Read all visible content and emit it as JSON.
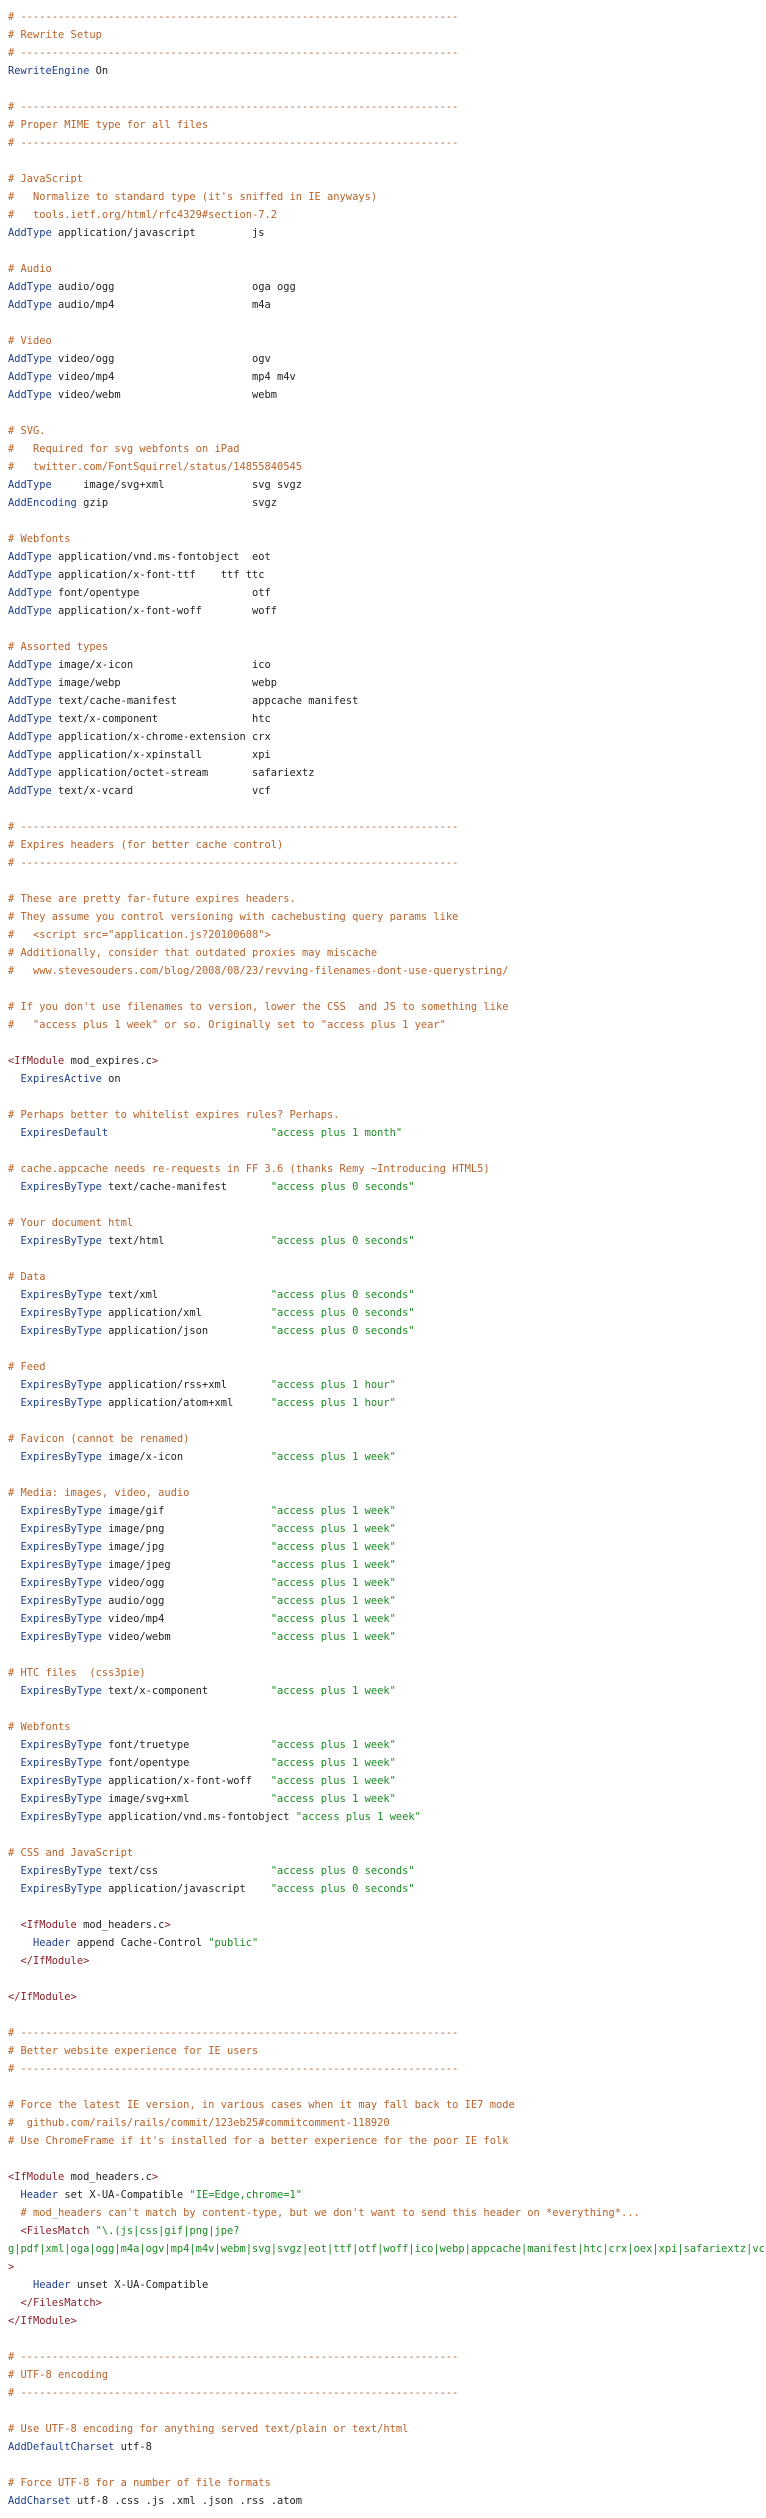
{
  "theme": {
    "comment": "#b8622a",
    "keyword": "#1d3f8a",
    "string": "#1a8a22",
    "plain": "#222222",
    "tag": "#8a1f2a"
  },
  "lines": [
    [
      [
        "c",
        "# ----------------------------------------------------------------------"
      ]
    ],
    [
      [
        "c",
        "# Rewrite Setup"
      ]
    ],
    [
      [
        "c",
        "# ----------------------------------------------------------------------"
      ]
    ],
    [
      [
        "k",
        "RewriteEngine"
      ],
      [
        "p",
        " On"
      ]
    ],
    [],
    [
      [
        "c",
        "# ----------------------------------------------------------------------"
      ]
    ],
    [
      [
        "c",
        "# Proper MIME type for all files"
      ]
    ],
    [
      [
        "c",
        "# ----------------------------------------------------------------------"
      ]
    ],
    [],
    [
      [
        "c",
        "# JavaScript"
      ]
    ],
    [
      [
        "c",
        "#   Normalize to standard type (it's sniffed in IE anyways)"
      ]
    ],
    [
      [
        "c",
        "#   tools.ietf.org/html/rfc4329#section-7.2"
      ]
    ],
    [
      [
        "k",
        "AddType"
      ],
      [
        "p",
        " application/javascript         js"
      ]
    ],
    [],
    [
      [
        "c",
        "# Audio"
      ]
    ],
    [
      [
        "k",
        "AddType"
      ],
      [
        "p",
        " audio/ogg                      oga ogg"
      ]
    ],
    [
      [
        "k",
        "AddType"
      ],
      [
        "p",
        " audio/mp4                      m4a"
      ]
    ],
    [],
    [
      [
        "c",
        "# Video"
      ]
    ],
    [
      [
        "k",
        "AddType"
      ],
      [
        "p",
        " video/ogg                      ogv"
      ]
    ],
    [
      [
        "k",
        "AddType"
      ],
      [
        "p",
        " video/mp4                      mp4 m4v"
      ]
    ],
    [
      [
        "k",
        "AddType"
      ],
      [
        "p",
        " video/webm                     webm"
      ]
    ],
    [],
    [
      [
        "c",
        "# SVG."
      ]
    ],
    [
      [
        "c",
        "#   Required for svg webfonts on iPad"
      ]
    ],
    [
      [
        "c",
        "#   twitter.com/FontSquirrel/status/14855840545"
      ]
    ],
    [
      [
        "k",
        "AddType"
      ],
      [
        "p",
        "     image/svg+xml              svg svgz"
      ]
    ],
    [
      [
        "k",
        "AddEncoding"
      ],
      [
        "p",
        " gzip                       svgz"
      ]
    ],
    [],
    [
      [
        "c",
        "# Webfonts"
      ]
    ],
    [
      [
        "k",
        "AddType"
      ],
      [
        "p",
        " application/vnd.ms-fontobject  eot"
      ]
    ],
    [
      [
        "k",
        "AddType"
      ],
      [
        "p",
        " application/x-font-ttf    ttf ttc"
      ]
    ],
    [
      [
        "k",
        "AddType"
      ],
      [
        "p",
        " font/opentype                  otf"
      ]
    ],
    [
      [
        "k",
        "AddType"
      ],
      [
        "p",
        " application/x-font-woff        woff"
      ]
    ],
    [],
    [
      [
        "c",
        "# Assorted types"
      ]
    ],
    [
      [
        "k",
        "AddType"
      ],
      [
        "p",
        " image/x-icon                   ico"
      ]
    ],
    [
      [
        "k",
        "AddType"
      ],
      [
        "p",
        " image/webp                     webp"
      ]
    ],
    [
      [
        "k",
        "AddType"
      ],
      [
        "p",
        " text/cache-manifest            appcache manifest"
      ]
    ],
    [
      [
        "k",
        "AddType"
      ],
      [
        "p",
        " text/x-component               htc"
      ]
    ],
    [
      [
        "k",
        "AddType"
      ],
      [
        "p",
        " application/x-chrome-extension crx"
      ]
    ],
    [
      [
        "k",
        "AddType"
      ],
      [
        "p",
        " application/x-xpinstall        xpi"
      ]
    ],
    [
      [
        "k",
        "AddType"
      ],
      [
        "p",
        " application/octet-stream       safariextz"
      ]
    ],
    [
      [
        "k",
        "AddType"
      ],
      [
        "p",
        " text/x-vcard                   vcf"
      ]
    ],
    [],
    [
      [
        "c",
        "# ----------------------------------------------------------------------"
      ]
    ],
    [
      [
        "c",
        "# Expires headers (for better cache control)"
      ]
    ],
    [
      [
        "c",
        "# ----------------------------------------------------------------------"
      ]
    ],
    [],
    [
      [
        "c",
        "# These are pretty far-future expires headers."
      ]
    ],
    [
      [
        "c",
        "# They assume you control versioning with cachebusting query params like"
      ]
    ],
    [
      [
        "c",
        "#   <script src=\"application.js?20100608\">"
      ]
    ],
    [
      [
        "c",
        "# Additionally, consider that outdated proxies may miscache"
      ]
    ],
    [
      [
        "c",
        "#   www.stevesouders.com/blog/2008/08/23/revving-filenames-dont-use-querystring/"
      ]
    ],
    [],
    [
      [
        "c",
        "# If you don't use filenames to version, lower the CSS  and JS to something like"
      ]
    ],
    [
      [
        "c",
        "#   \"access plus 1 week\" or so. Originally set to \"access plus 1 year\""
      ]
    ],
    [],
    [
      [
        "g",
        "<IfModule"
      ],
      [
        "p",
        " mod_expires.c"
      ],
      [
        "g",
        ">"
      ]
    ],
    [
      [
        "p",
        "  "
      ],
      [
        "k",
        "ExpiresActive"
      ],
      [
        "p",
        " on"
      ]
    ],
    [],
    [
      [
        "c",
        "# Perhaps better to whitelist expires rules? Perhaps."
      ]
    ],
    [
      [
        "p",
        "  "
      ],
      [
        "k",
        "ExpiresDefault"
      ],
      [
        "p",
        "                          "
      ],
      [
        "s",
        "\"access plus 1 month\""
      ]
    ],
    [],
    [
      [
        "c",
        "# cache.appcache needs re-requests in FF 3.6 (thanks Remy ~Introducing HTML5)"
      ]
    ],
    [
      [
        "p",
        "  "
      ],
      [
        "k",
        "ExpiresByType"
      ],
      [
        "p",
        " text/cache-manifest       "
      ],
      [
        "s",
        "\"access plus 0 seconds\""
      ]
    ],
    [],
    [
      [
        "c",
        "# Your document html"
      ]
    ],
    [
      [
        "p",
        "  "
      ],
      [
        "k",
        "ExpiresByType"
      ],
      [
        "p",
        " text/html                 "
      ],
      [
        "s",
        "\"access plus 0 seconds\""
      ]
    ],
    [],
    [
      [
        "c",
        "# Data"
      ]
    ],
    [
      [
        "p",
        "  "
      ],
      [
        "k",
        "ExpiresByType"
      ],
      [
        "p",
        " text/xml                  "
      ],
      [
        "s",
        "\"access plus 0 seconds\""
      ]
    ],
    [
      [
        "p",
        "  "
      ],
      [
        "k",
        "ExpiresByType"
      ],
      [
        "p",
        " application/xml           "
      ],
      [
        "s",
        "\"access plus 0 seconds\""
      ]
    ],
    [
      [
        "p",
        "  "
      ],
      [
        "k",
        "ExpiresByType"
      ],
      [
        "p",
        " application/json          "
      ],
      [
        "s",
        "\"access plus 0 seconds\""
      ]
    ],
    [],
    [
      [
        "c",
        "# Feed"
      ]
    ],
    [
      [
        "p",
        "  "
      ],
      [
        "k",
        "ExpiresByType"
      ],
      [
        "p",
        " application/rss+xml       "
      ],
      [
        "s",
        "\"access plus 1 hour\""
      ]
    ],
    [
      [
        "p",
        "  "
      ],
      [
        "k",
        "ExpiresByType"
      ],
      [
        "p",
        " application/atom+xml      "
      ],
      [
        "s",
        "\"access plus 1 hour\""
      ]
    ],
    [],
    [
      [
        "c",
        "# Favicon (cannot be renamed)"
      ]
    ],
    [
      [
        "p",
        "  "
      ],
      [
        "k",
        "ExpiresByType"
      ],
      [
        "p",
        " image/x-icon              "
      ],
      [
        "s",
        "\"access plus 1 week\""
      ]
    ],
    [],
    [
      [
        "c",
        "# Media: images, video, audio"
      ]
    ],
    [
      [
        "p",
        "  "
      ],
      [
        "k",
        "ExpiresByType"
      ],
      [
        "p",
        " image/gif                 "
      ],
      [
        "s",
        "\"access plus 1 week\""
      ]
    ],
    [
      [
        "p",
        "  "
      ],
      [
        "k",
        "ExpiresByType"
      ],
      [
        "p",
        " image/png                 "
      ],
      [
        "s",
        "\"access plus 1 week\""
      ]
    ],
    [
      [
        "p",
        "  "
      ],
      [
        "k",
        "ExpiresByType"
      ],
      [
        "p",
        " image/jpg                 "
      ],
      [
        "s",
        "\"access plus 1 week\""
      ]
    ],
    [
      [
        "p",
        "  "
      ],
      [
        "k",
        "ExpiresByType"
      ],
      [
        "p",
        " image/jpeg                "
      ],
      [
        "s",
        "\"access plus 1 week\""
      ]
    ],
    [
      [
        "p",
        "  "
      ],
      [
        "k",
        "ExpiresByType"
      ],
      [
        "p",
        " video/ogg                 "
      ],
      [
        "s",
        "\"access plus 1 week\""
      ]
    ],
    [
      [
        "p",
        "  "
      ],
      [
        "k",
        "ExpiresByType"
      ],
      [
        "p",
        " audio/ogg                 "
      ],
      [
        "s",
        "\"access plus 1 week\""
      ]
    ],
    [
      [
        "p",
        "  "
      ],
      [
        "k",
        "ExpiresByType"
      ],
      [
        "p",
        " video/mp4                 "
      ],
      [
        "s",
        "\"access plus 1 week\""
      ]
    ],
    [
      [
        "p",
        "  "
      ],
      [
        "k",
        "ExpiresByType"
      ],
      [
        "p",
        " video/webm                "
      ],
      [
        "s",
        "\"access plus 1 week\""
      ]
    ],
    [],
    [
      [
        "c",
        "# HTC files  (css3pie)"
      ]
    ],
    [
      [
        "p",
        "  "
      ],
      [
        "k",
        "ExpiresByType"
      ],
      [
        "p",
        " text/x-component          "
      ],
      [
        "s",
        "\"access plus 1 week\""
      ]
    ],
    [],
    [
      [
        "c",
        "# Webfonts"
      ]
    ],
    [
      [
        "p",
        "  "
      ],
      [
        "k",
        "ExpiresByType"
      ],
      [
        "p",
        " font/truetype             "
      ],
      [
        "s",
        "\"access plus 1 week\""
      ]
    ],
    [
      [
        "p",
        "  "
      ],
      [
        "k",
        "ExpiresByType"
      ],
      [
        "p",
        " font/opentype             "
      ],
      [
        "s",
        "\"access plus 1 week\""
      ]
    ],
    [
      [
        "p",
        "  "
      ],
      [
        "k",
        "ExpiresByType"
      ],
      [
        "p",
        " application/x-font-woff   "
      ],
      [
        "s",
        "\"access plus 1 week\""
      ]
    ],
    [
      [
        "p",
        "  "
      ],
      [
        "k",
        "ExpiresByType"
      ],
      [
        "p",
        " image/svg+xml             "
      ],
      [
        "s",
        "\"access plus 1 week\""
      ]
    ],
    [
      [
        "p",
        "  "
      ],
      [
        "k",
        "ExpiresByType"
      ],
      [
        "p",
        " application/vnd.ms-fontobject "
      ],
      [
        "s",
        "\"access plus 1 week\""
      ]
    ],
    [],
    [
      [
        "c",
        "# CSS and JavaScript"
      ]
    ],
    [
      [
        "p",
        "  "
      ],
      [
        "k",
        "ExpiresByType"
      ],
      [
        "p",
        " text/css                  "
      ],
      [
        "s",
        "\"access plus 0 seconds\""
      ]
    ],
    [
      [
        "p",
        "  "
      ],
      [
        "k",
        "ExpiresByType"
      ],
      [
        "p",
        " application/javascript    "
      ],
      [
        "s",
        "\"access plus 0 seconds\""
      ]
    ],
    [],
    [
      [
        "p",
        "  "
      ],
      [
        "g",
        "<IfModule"
      ],
      [
        "p",
        " mod_headers.c"
      ],
      [
        "g",
        ">"
      ]
    ],
    [
      [
        "p",
        "    "
      ],
      [
        "k",
        "Header"
      ],
      [
        "p",
        " append Cache-Control "
      ],
      [
        "s",
        "\"public\""
      ]
    ],
    [
      [
        "p",
        "  "
      ],
      [
        "g",
        "</IfModule>"
      ]
    ],
    [],
    [
      [
        "g",
        "</IfModule>"
      ]
    ],
    [],
    [
      [
        "c",
        "# ----------------------------------------------------------------------"
      ]
    ],
    [
      [
        "c",
        "# Better website experience for IE users"
      ]
    ],
    [
      [
        "c",
        "# ----------------------------------------------------------------------"
      ]
    ],
    [],
    [
      [
        "c",
        "# Force the latest IE version, in various cases when it may fall back to IE7 mode"
      ]
    ],
    [
      [
        "c",
        "#  github.com/rails/rails/commit/123eb25#commitcomment-118920"
      ]
    ],
    [
      [
        "c",
        "# Use ChromeFrame if it's installed for a better experience for the poor IE folk"
      ]
    ],
    [],
    [
      [
        "g",
        "<IfModule"
      ],
      [
        "p",
        " mod_headers.c"
      ],
      [
        "g",
        ">"
      ]
    ],
    [
      [
        "p",
        "  "
      ],
      [
        "k",
        "Header"
      ],
      [
        "p",
        " set X-UA-Compatible "
      ],
      [
        "s",
        "\"IE=Edge,chrome=1\""
      ]
    ],
    [
      [
        "p",
        "  "
      ],
      [
        "c",
        "# mod_headers can't match by content-type, but we don't want to send this header on *everything*..."
      ]
    ],
    [
      [
        "p",
        "  "
      ],
      [
        "g",
        "<FilesMatch"
      ],
      [
        "p",
        " "
      ],
      [
        "s",
        "\"\\.(js|css|gif|png|jpe?"
      ]
    ],
    [
      [
        "s",
        "g|pdf|xml|oga|ogg|m4a|ogv|mp4|m4v|webm|svg|svgz|eot|ttf|otf|woff|ico|webp|appcache|manifest|htc|crx|oex|xpi|safariextz|vcf)$\""
      ]
    ],
    [
      [
        "g",
        ">"
      ]
    ],
    [
      [
        "p",
        "    "
      ],
      [
        "k",
        "Header"
      ],
      [
        "p",
        " unset X-UA-Compatible"
      ]
    ],
    [
      [
        "p",
        "  "
      ],
      [
        "g",
        "</FilesMatch>"
      ]
    ],
    [
      [
        "g",
        "</IfModule>"
      ]
    ],
    [],
    [
      [
        "c",
        "# ----------------------------------------------------------------------"
      ]
    ],
    [
      [
        "c",
        "# UTF-8 encoding"
      ]
    ],
    [
      [
        "c",
        "# ----------------------------------------------------------------------"
      ]
    ],
    [],
    [
      [
        "c",
        "# Use UTF-8 encoding for anything served text/plain or text/html"
      ]
    ],
    [
      [
        "k",
        "AddDefaultCharset"
      ],
      [
        "p",
        " utf-8"
      ]
    ],
    [],
    [
      [
        "c",
        "# Force UTF-8 for a number of file formats"
      ]
    ],
    [
      [
        "k",
        "AddCharset"
      ],
      [
        "p",
        " utf-8 .css .js .xml .json .rss .atom"
      ]
    ]
  ]
}
